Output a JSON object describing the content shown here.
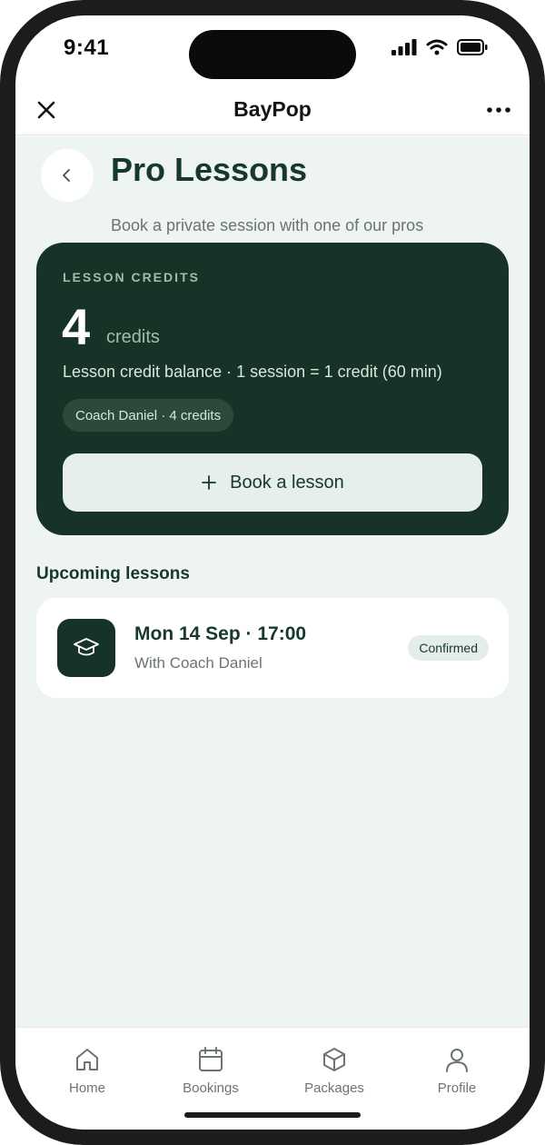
{
  "status_bar": {
    "time": "9:41"
  },
  "app_bar": {
    "title": "BayPop"
  },
  "page": {
    "title": "Pro Lessons",
    "subtitle": "Book a private session with one of our pros"
  },
  "credits_card": {
    "label": "LESSON CREDITS",
    "count": "4",
    "unit": "credits",
    "description": "Lesson credit balance · 1 session = 1 credit (60 min)",
    "coach_chip": "Coach Daniel · 4 credits",
    "book_button": "Book a lesson"
  },
  "upcoming": {
    "title": "Upcoming lessons",
    "lessons": [
      {
        "when": "Mon 14 Sep · 17:00",
        "with": "With Coach Daniel",
        "status": "Confirmed"
      }
    ]
  },
  "tabbar": {
    "items": [
      {
        "label": "Home",
        "icon": "home-icon"
      },
      {
        "label": "Bookings",
        "icon": "calendar-icon"
      },
      {
        "label": "Packages",
        "icon": "package-icon"
      },
      {
        "label": "Profile",
        "icon": "person-icon"
      }
    ]
  },
  "colors": {
    "brand_dark": "#173226",
    "background": "#eef4f0",
    "title_green": "#17392b"
  }
}
